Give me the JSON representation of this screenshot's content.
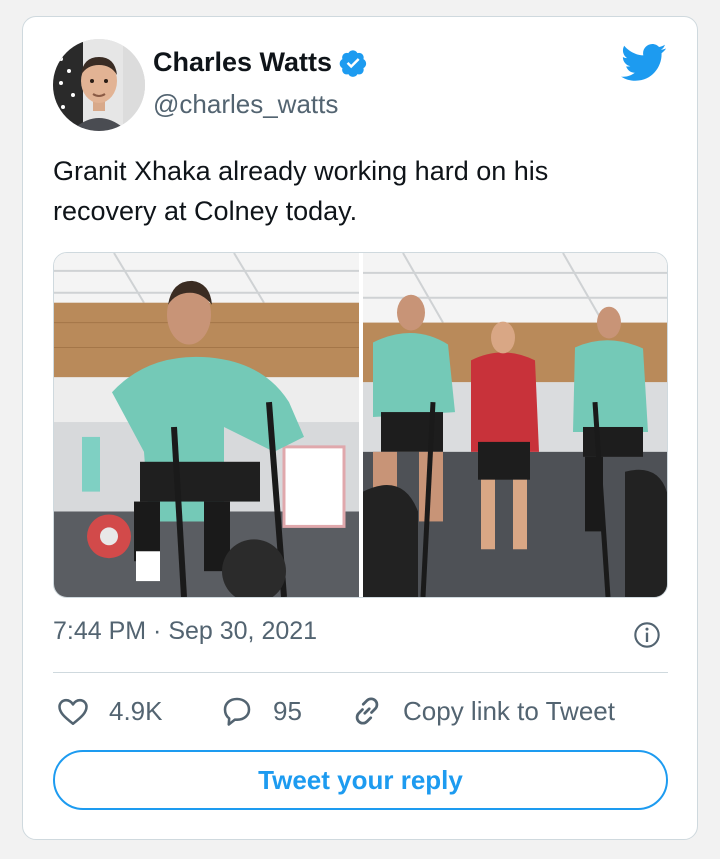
{
  "author": {
    "name": "Charles Watts",
    "handle": "@charles_watts"
  },
  "tweet": {
    "text": "Granit Xhaka already working hard on his recovery at Colney today.",
    "timestamp": "7:44 PM · Sep 30, 2021"
  },
  "media": {
    "photos": [
      {
        "icon": "photo-xhaka-bike"
      },
      {
        "icon": "photo-training-group"
      }
    ]
  },
  "actions": {
    "like_count": "4.9K",
    "reply_count": "95",
    "copy_link_label": "Copy link to Tweet"
  },
  "reply_button_label": "Tweet your reply",
  "colors": {
    "accent": "#1d9bf0",
    "text": "#0f1419",
    "secondary": "#536471",
    "border": "#cfd9de"
  }
}
